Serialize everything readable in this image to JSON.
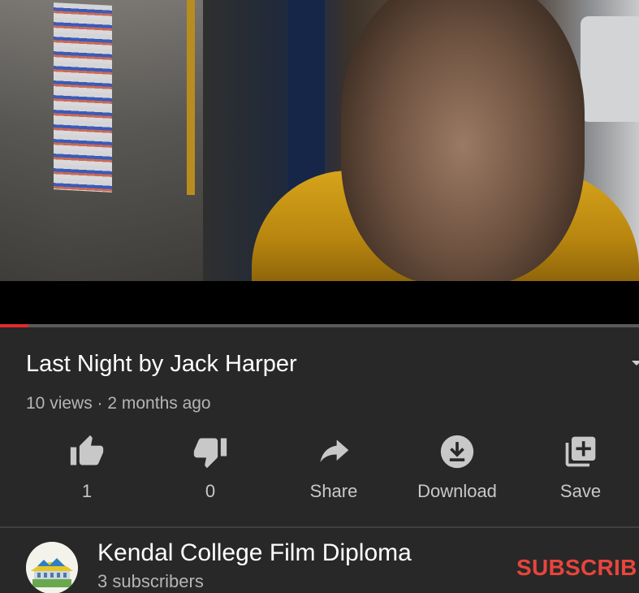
{
  "player": {
    "progress_fraction": 0.045,
    "accent_color": "#e32a2a"
  },
  "video": {
    "title": "Last Night by Jack Harper",
    "meta": "10 views · 2 months ago"
  },
  "actions": [
    {
      "icon": "thumbs-up-icon",
      "label": "1"
    },
    {
      "icon": "thumbs-down-icon",
      "label": "0"
    },
    {
      "icon": "share-icon",
      "label": "Share"
    },
    {
      "icon": "download-icon",
      "label": "Download"
    },
    {
      "icon": "add-to-playlist-icon",
      "label": "Save"
    }
  ],
  "channel": {
    "name": "Kendal College Film Diploma",
    "subscribers": "3 subscribers",
    "subscribe_label": "SUBSCRIB",
    "subscribe_color": "#e8453c"
  }
}
